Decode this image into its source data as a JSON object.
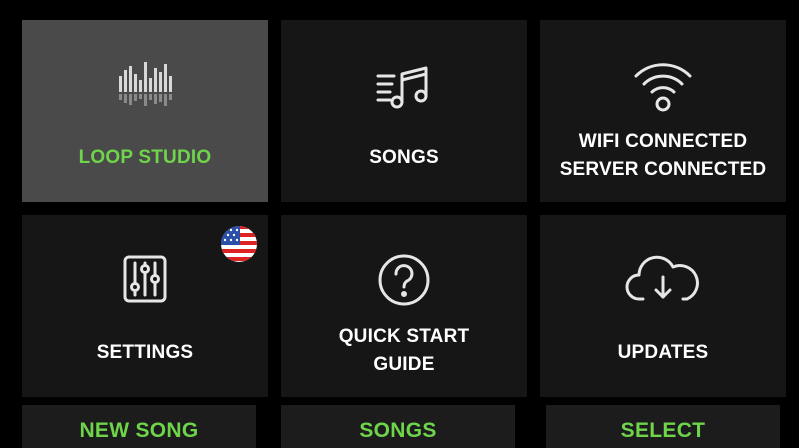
{
  "tiles": [
    {
      "label": "LOOP STUDIO",
      "icon": "waveform-icon",
      "selected": true
    },
    {
      "label": "SONGS",
      "icon": "music-list-icon",
      "selected": false
    },
    {
      "label": "WIFI CONNECTED\nSERVER CONNECTED",
      "icon": "wifi-icon",
      "selected": false
    },
    {
      "label": "SETTINGS",
      "icon": "sliders-icon",
      "selected": false,
      "badge": "us-flag-icon"
    },
    {
      "label": "QUICK START\nGUIDE",
      "icon": "help-circle-icon",
      "selected": false
    },
    {
      "label": "UPDATES",
      "icon": "cloud-download-icon",
      "selected": false
    }
  ],
  "softkeys": [
    "NEW SONG",
    "SONGS",
    "SELECT"
  ],
  "colors": {
    "accent": "#6ed44a",
    "tile": "#161616",
    "tile_selected": "#4a4a4a",
    "text": "#ffffff"
  }
}
